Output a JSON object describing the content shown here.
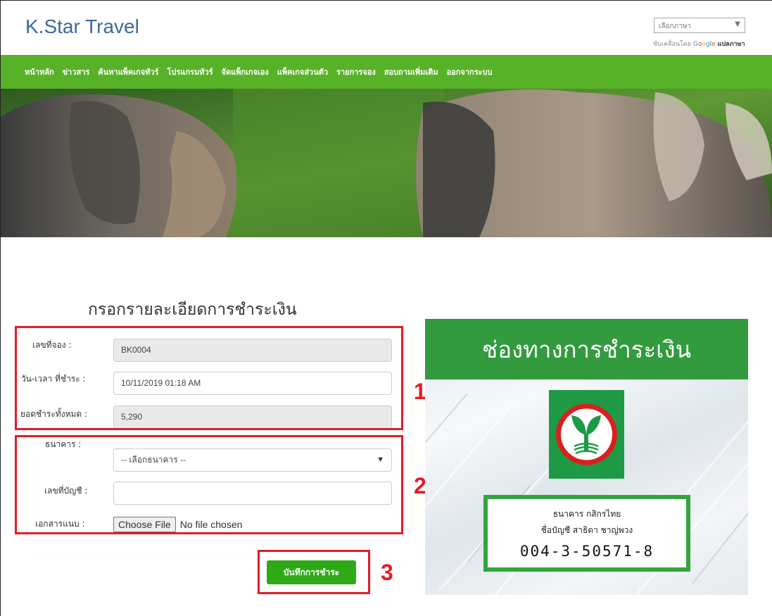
{
  "header": {
    "site_title": "K.Star Travel",
    "language_select": "เลือกภาษา",
    "powered_by": "ขับเคลื่อนโดย",
    "google_letters": [
      "G",
      "o",
      "o",
      "g",
      "l",
      "e"
    ],
    "translate_label": "แปลภาษา"
  },
  "nav": {
    "items": [
      "หน้าหลัก",
      "ข่าวสาร",
      "ค้นหาแพ็คเกจทัวร์",
      "โปรแกรมทัวร์",
      "จัดแพ็กเกจเอง",
      "แพ็คเกจส่วนตัว",
      "รายการจอง",
      "สอบถามเพิ่มเติม",
      "ออกจากระบบ"
    ]
  },
  "form": {
    "title": "กรอกรายละเอียดการชำระเงิน",
    "booking_no_label": "เลขที่จอง :",
    "booking_no_value": "BK0004",
    "datetime_label": "วัน-เวลา ที่ชำระ :",
    "datetime_value": "10/11/2019 01:18 AM",
    "total_label": "ยอดชำระทั้งหมด :",
    "total_value": "5,290",
    "bank_label": "ธนาคาร :",
    "bank_selected": "-- เลือกธนาคาร --",
    "account_label": "เลขที่บัญชี :",
    "account_value": "",
    "attachment_label": "เอกสารแนบ :",
    "choose_file": "Choose File",
    "no_file": "No file chosen",
    "save_button": "บันทึกการชำระ"
  },
  "annotations": {
    "box1": "1",
    "box2": "2",
    "box3": "3"
  },
  "payment": {
    "header": "ช่องทางการชำระเงิน",
    "bank_name": "ธนาคาร กสิกรไทย",
    "account_name": "ชื่อบัญชี สาธิตา ชาญ่พวง",
    "account_number": "004-3-50571-8"
  },
  "colors": {
    "nav_green": "#58b227",
    "save_green": "#2eaa16",
    "panel_green": "#319b3d",
    "annotation_red": "#e51c24",
    "title_blue": "#3a6a9c"
  }
}
